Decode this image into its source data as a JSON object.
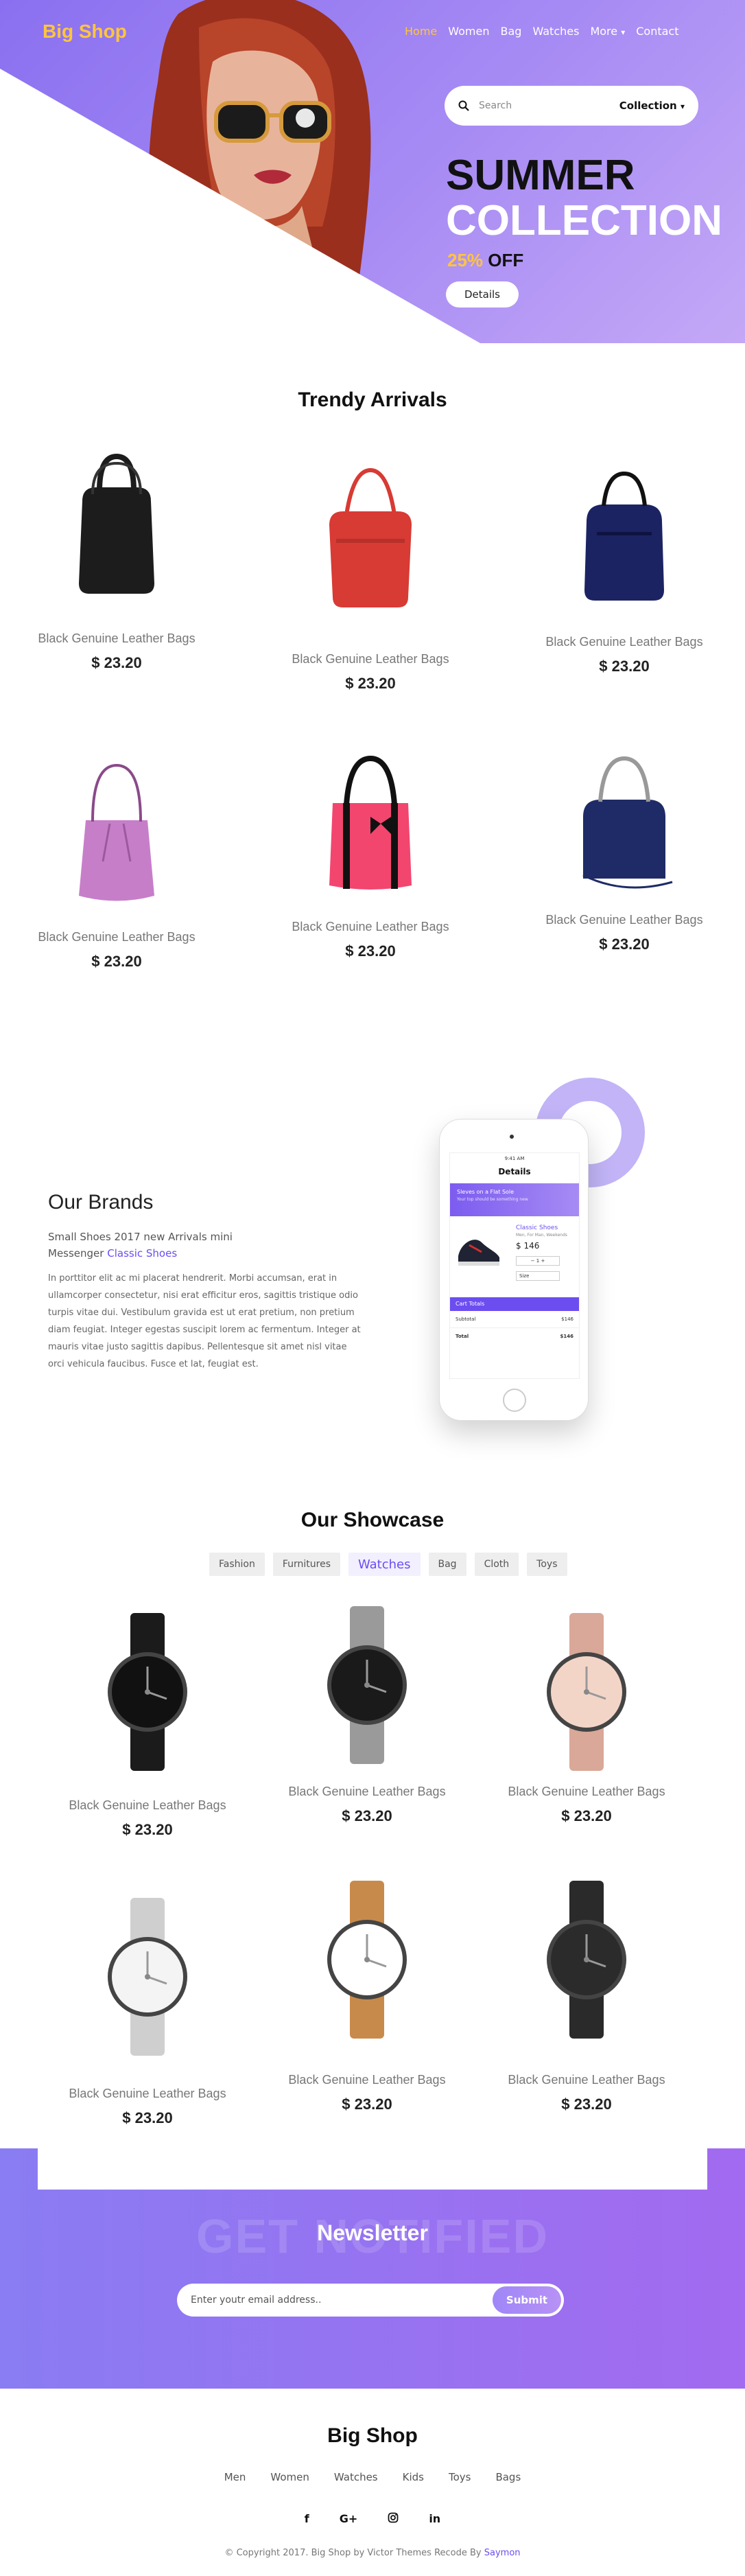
{
  "brand": {
    "logo": "Big Shop"
  },
  "nav": {
    "items": [
      "Home",
      "Women",
      "Bag",
      "Watches",
      "More",
      "Contact"
    ],
    "active": "Home"
  },
  "hero": {
    "search_placeholder": "Search",
    "search_select": "Collection",
    "title_line1": "SUMMER",
    "title_line2": "COLLECTION",
    "offer_pct": "25%",
    "offer_text": " OFF",
    "cta": "Details"
  },
  "trendy": {
    "title": "Trendy Arrivals",
    "products": [
      {
        "name": "Black Genuine Leather Bags",
        "price": "$ 23.20",
        "color": "#1c1c1c"
      },
      {
        "name": "Black Genuine Leather Bags",
        "price": "$ 23.20",
        "color": "#d83a34"
      },
      {
        "name": "Black Genuine Leather Bags",
        "price": "$ 23.20",
        "color": "#1c2363"
      },
      {
        "name": "Black Genuine Leather Bags",
        "price": "$ 23.20",
        "color": "#c77ec9"
      },
      {
        "name": "Black Genuine Leather Bags",
        "price": "$ 23.20",
        "color": "#f2466f"
      },
      {
        "name": "Black Genuine Leather Bags",
        "price": "$ 23.20",
        "color": "#1f2b66"
      }
    ]
  },
  "brands": {
    "title": "Our Brands",
    "sub": "Small Shoes 2017 new Arrivals mini Messenger ",
    "sub_link": "Classic Shoes",
    "body": "In porttitor elit ac mi placerat hendrerit. Morbi accumsan, erat in ullamcorper consectetur, nisi erat efficitur eros, sagittis tristique odio turpis vitae dui. Vestibulum gravida est ut erat pretium, non pretium diam feugiat. Integer egestas suscipit lorem ac fermentum. Integer at mauris vitae justo sagittis dapibus. Pellentesque sit amet nisl vitae orci vehicula faucibus. Fusce et lat, feugiat est.",
    "phone": {
      "status_time": "9:41 AM",
      "header": "Details",
      "banner_title": "Sleves on a Flat Sole",
      "banner_sub": "Your top should be something new",
      "item_name": "Classic Shoes",
      "item_sub": "Men, For Man, Weekends",
      "item_price": "$ 146",
      "qty": "1",
      "size": "Size",
      "cart_header": "Cart Totals",
      "subtotal_label": "Subtotal",
      "subtotal_value": "$146",
      "total_label": "Total",
      "total_value": "$146"
    }
  },
  "showcase": {
    "title": "Our Showcase",
    "tabs": [
      "Fashion",
      "Furnitures",
      "Watches",
      "Bag",
      "Cloth",
      "Toys"
    ],
    "active_tab": "Watches",
    "products": [
      {
        "name": "Black Genuine Leather Bags",
        "price": "$ 23.20",
        "strap": "#1b1b1b",
        "face": "#111111"
      },
      {
        "name": "Black Genuine Leather Bags",
        "price": "$ 23.20",
        "strap": "#9a9a9a",
        "face": "#1a1a1a"
      },
      {
        "name": "Black Genuine Leather Bags",
        "price": "$ 23.20",
        "strap": "#d9a898",
        "face": "#f3d5c8"
      },
      {
        "name": "Black Genuine Leather Bags",
        "price": "$ 23.20",
        "strap": "#cfcfcf",
        "face": "#f4f4f4"
      },
      {
        "name": "Black Genuine Leather Bags",
        "price": "$ 23.20",
        "strap": "#c88a4a",
        "face": "#ffffff"
      },
      {
        "name": "Black Genuine Leather Bags",
        "price": "$ 23.20",
        "strap": "#2a2a2a",
        "face": "#2b2b2b"
      }
    ]
  },
  "newsletter": {
    "ghost": "GET NOTIFIED",
    "title": "Newsletter",
    "placeholder": "Enter youtr email address..",
    "button": "Submit"
  },
  "footer": {
    "title": "Big Shop",
    "links": [
      "Men",
      "Women",
      "Watches",
      "Kids",
      "Toys",
      "Bags"
    ],
    "social": [
      "f",
      "G+",
      "instagram-icon",
      "in"
    ],
    "copyright": "© Copyright 2017. Big Shop by Victor Themes Recode By ",
    "copyright_link": "Saymon"
  }
}
